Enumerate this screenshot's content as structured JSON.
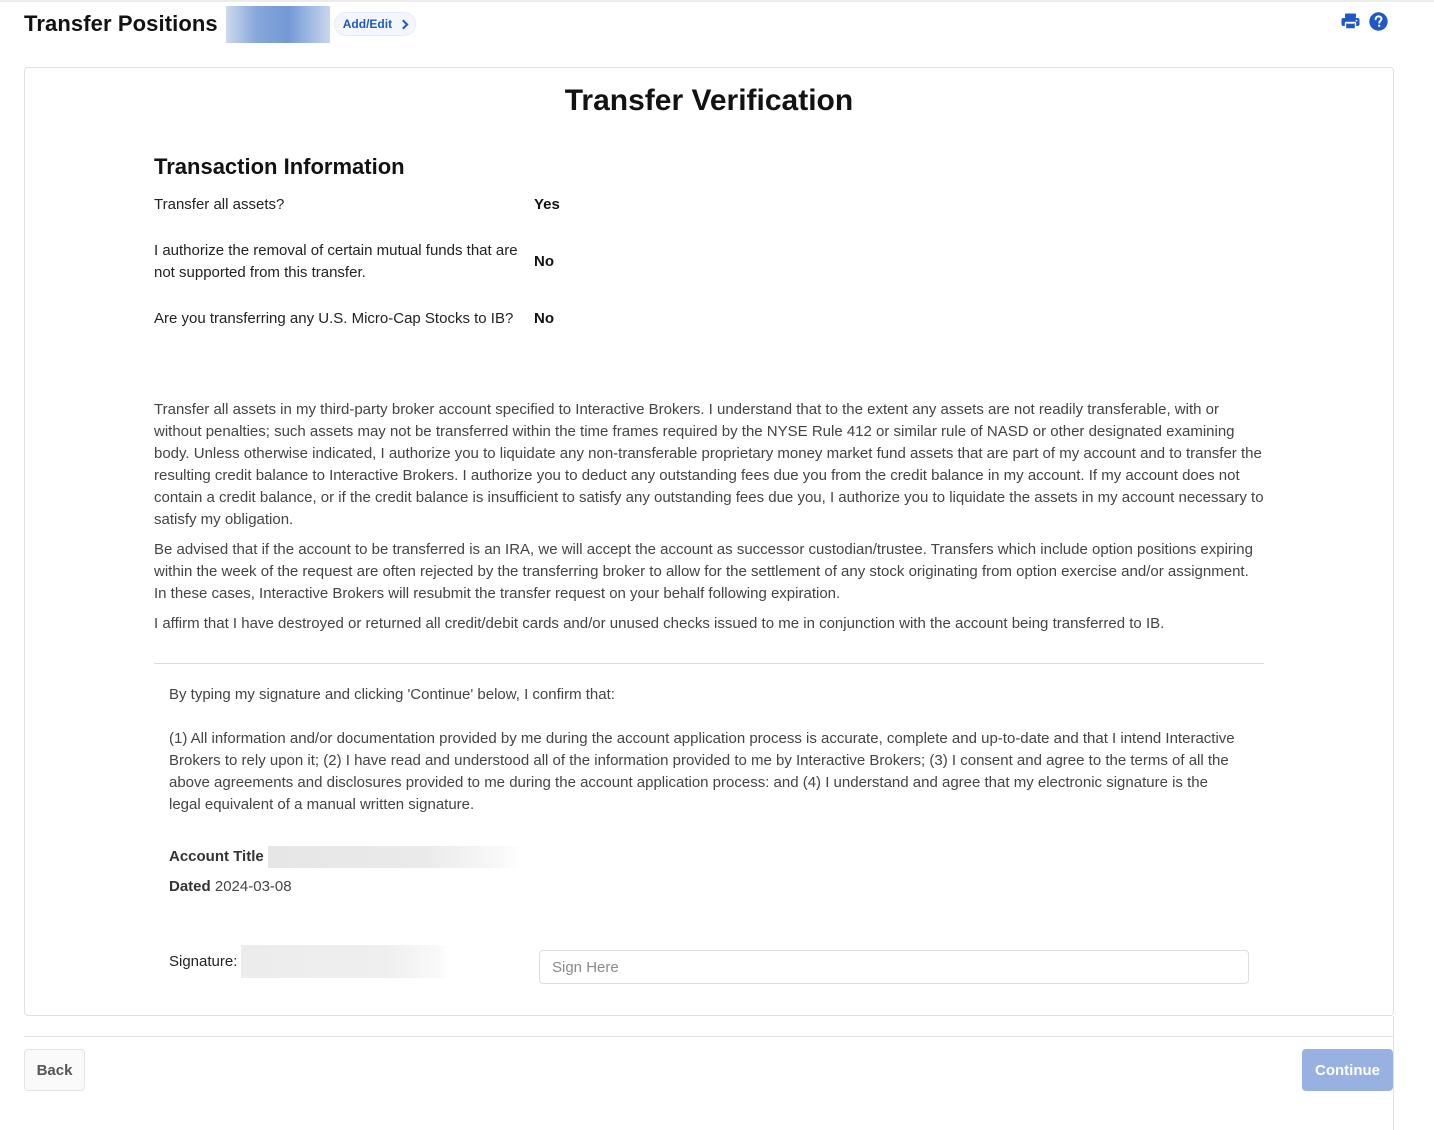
{
  "header": {
    "title": "Transfer Positions",
    "add_edit_label": "Add/Edit",
    "icons": [
      "print-icon",
      "help-icon"
    ]
  },
  "colors": {
    "accent": "#1f58c4",
    "continue_disabled_bg": "#98b1e1"
  },
  "card": {
    "title": "Transfer Verification",
    "section_title": "Transaction Information",
    "questions": [
      {
        "question": "Transfer all assets?",
        "answer": "Yes"
      },
      {
        "question": "I authorize the removal of certain mutual funds that are not supported from this transfer.",
        "answer": "No"
      },
      {
        "question": "Are you transferring any U.S. Micro-Cap Stocks to IB?",
        "answer": "No"
      }
    ],
    "legal_paragraphs": [
      "Transfer all assets in my third-party broker account specified to Interactive Brokers. I understand that to the extent any assets are not readily transferable, with or without penalties; such assets may not be transferred within the time frames required by the NYSE Rule 412 or similar rule of NASD or other designated examining body. Unless otherwise indicated, I authorize you to liquidate any non-transferable proprietary money market fund assets that are part of my account and to transfer the resulting credit balance to Interactive Brokers. I authorize you to deduct any outstanding fees due you from the credit balance in my account. If my account does not contain a credit balance, or if the credit balance is insufficient to satisfy any outstanding fees due you, I authorize you to liquidate the assets in my account necessary to satisfy my obligation.",
      "Be advised that if the account to be transferred is an IRA, we will accept the account as successor custodian/trustee. Transfers which include option positions expiring within the week of the request are often rejected by the transferring broker to allow for the settlement of any stock originating from option exercise and/or assignment. In these cases, Interactive Brokers will resubmit the transfer request on your behalf following expiration.",
      "I affirm that I have destroyed or returned all credit/debit cards and/or unused checks issued to me in conjunction with the account being transferred to IB."
    ],
    "confirm_lead": "By typing my signature and clicking 'Continue' below, I confirm that:",
    "confirm_body": "(1) All information and/or documentation provided by me during the account application process is accurate, complete and up-to-date and that I intend Interactive Brokers to rely upon it; (2) I have read and understood all of the information provided to me by Interactive Brokers; (3) I consent and agree to the terms of all the above agreements and disclosures provided to me during the account application process: and (4) I understand and agree that my electronic signature is the legal equivalent of a manual written signature.",
    "account_title_label": "Account Title",
    "dated_label": "Dated",
    "dated_value": "2024-03-08",
    "signature_label": "Signature:",
    "signature_input": {
      "value": "",
      "placeholder": "Sign Here"
    }
  },
  "footer": {
    "back_label": "Back",
    "continue_label": "Continue"
  }
}
